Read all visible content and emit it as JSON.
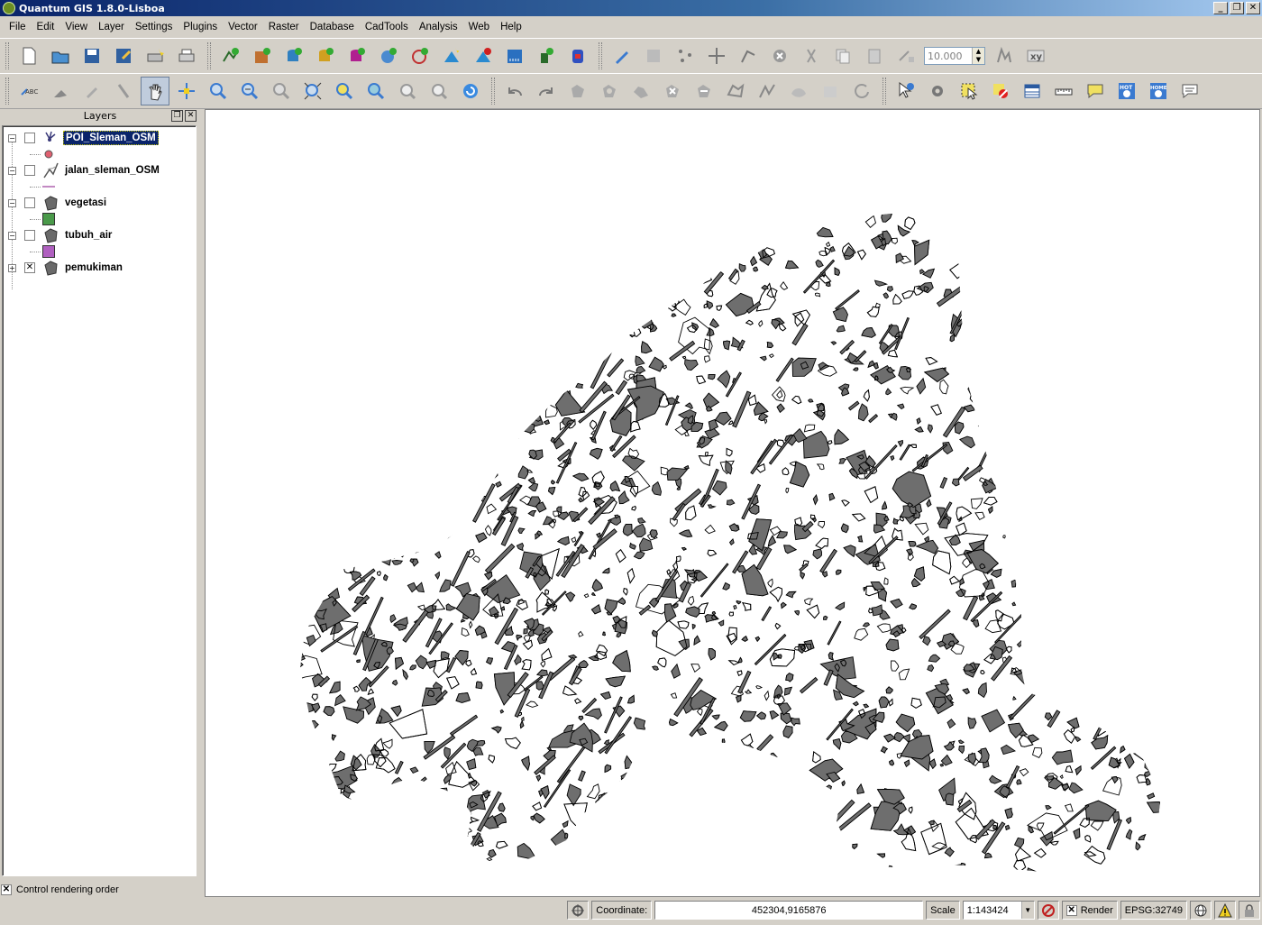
{
  "window": {
    "title": "Quantum GIS 1.8.0-Lisboa"
  },
  "menubar": [
    "File",
    "Edit",
    "View",
    "Layer",
    "Settings",
    "Plugins",
    "Vector",
    "Raster",
    "Database",
    "CadTools",
    "Analysis",
    "Web",
    "Help"
  ],
  "toolbar": {
    "snap_value": "10.000"
  },
  "layers_panel": {
    "title": "Layers",
    "layers": [
      {
        "name": "POI_Sleman_OSM",
        "checked": false,
        "selected": true,
        "geometry": "point",
        "symbol_color": "#e06070"
      },
      {
        "name": "jalan_sleman_OSM",
        "checked": false,
        "selected": false,
        "geometry": "line",
        "symbol_color": "#9b3c9b"
      },
      {
        "name": "vegetasi",
        "checked": false,
        "selected": false,
        "geometry": "polygon",
        "symbol_color": "#4a9a4a"
      },
      {
        "name": "tubuh_air",
        "checked": false,
        "selected": false,
        "geometry": "polygon",
        "symbol_color": "#b060c0"
      },
      {
        "name": "pemukiman",
        "checked": true,
        "selected": false,
        "geometry": "polygon",
        "symbol_color": "#6e6e6e"
      }
    ],
    "control_rendering_order": "Control rendering order"
  },
  "map": {
    "fill_color": "#6e6e6e",
    "outline_color": "#000000",
    "background": "#ffffff"
  },
  "statusbar": {
    "coordinate_label": "Coordinate:",
    "coordinate_value": "452304,9165876",
    "scale_label": "Scale",
    "scale_value": "1:143424",
    "render_label": "Render",
    "crs": "EPSG:32749"
  }
}
